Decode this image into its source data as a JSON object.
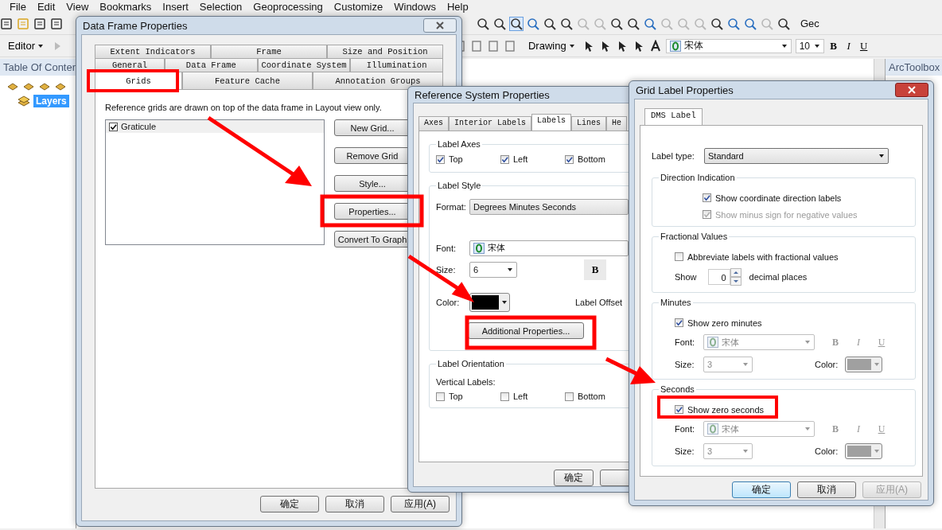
{
  "menu": [
    "File",
    "Edit",
    "View",
    "Bookmarks",
    "Insert",
    "Selection",
    "Geoprocessing",
    "Customize",
    "Windows",
    "Help"
  ],
  "toolbar": {
    "editor_menu": "Editor",
    "drawing_menu": "Drawing",
    "font": "宋体",
    "font_size": "10",
    "bold": "B",
    "italic": "I",
    "underline": "U",
    "cut_label": "Gec"
  },
  "toc": {
    "title": "Table Of Conten",
    "layers": {
      "label": "Layers",
      "selected": true
    }
  },
  "arctoolbox": {
    "title": "ArcToolbox"
  },
  "data_frame_dialog": {
    "title": "Data Frame Properties",
    "tab_rows": [
      [
        {
          "label": "Extent Indicators",
          "selected": false
        },
        {
          "label": "Frame",
          "selected": false
        },
        {
          "label": "Size and Position",
          "selected": false
        }
      ],
      [
        {
          "label": "General",
          "selected": false
        },
        {
          "label": "Data Frame",
          "selected": false
        },
        {
          "label": "Coordinate System",
          "selected": false
        },
        {
          "label": "Illumination",
          "selected": false
        }
      ],
      [
        {
          "label": "Grids",
          "selected": true
        },
        {
          "label": "Feature Cache",
          "selected": false
        },
        {
          "label": "Annotation Groups",
          "selected": false
        }
      ]
    ],
    "description": "Reference grids are drawn on top of the data frame in Layout view only.",
    "grids": [
      {
        "label": "Graticule",
        "checked": true
      }
    ],
    "buttons": [
      "New Grid...",
      "Remove Grid",
      "Style...",
      "Properties...",
      "Convert To Graph"
    ],
    "footer_buttons": [
      {
        "label": "确定",
        "disabled": false
      },
      {
        "label": "取消",
        "disabled": false
      },
      {
        "label": "应用(A)",
        "disabled": false
      }
    ]
  },
  "reference_dialog": {
    "title": "Reference System Properties",
    "tabs": [
      {
        "label": "Axes",
        "selected": false
      },
      {
        "label": "Interior Labels",
        "selected": false
      },
      {
        "label": "Labels",
        "selected": true
      },
      {
        "label": "Lines",
        "selected": false
      },
      {
        "label": "He",
        "selected": false
      }
    ],
    "label_axes": {
      "legend": "Label Axes",
      "options": [
        {
          "label": "Top",
          "checked": true
        },
        {
          "label": "Left",
          "checked": true
        },
        {
          "label": "Bottom",
          "checked": true
        }
      ]
    },
    "label_style": {
      "legend": "Label Style",
      "format_label": "Format:",
      "format": "Degrees Minutes Seconds",
      "font_label": "Font:",
      "font": "宋体",
      "size_label": "Size:",
      "size": "6",
      "bold": "B",
      "color_label": "Color:",
      "color": "#000000",
      "offset_label": "Label Offset",
      "additional_button": "Additional Properties..."
    },
    "label_orientation": {
      "legend": "Label Orientation",
      "vertical_label": "Vertical Labels:",
      "options": [
        {
          "label": "Top",
          "checked": false
        },
        {
          "label": "Left",
          "checked": false
        },
        {
          "label": "Bottom",
          "checked": false
        }
      ]
    },
    "footer_buttons": [
      "确定"
    ]
  },
  "grid_label_dialog": {
    "title": "Grid Label Properties",
    "tabs": [
      {
        "label": "DMS Label",
        "selected": true
      }
    ],
    "label_type_label": "Label type:",
    "label_type": "Standard",
    "direction": {
      "legend": "Direction Indication",
      "options": [
        {
          "label": "Show coordinate direction labels",
          "checked": true,
          "disabled": false
        },
        {
          "label": "Show minus sign for negative values",
          "checked": true,
          "disabled": true
        }
      ]
    },
    "fractional": {
      "legend": "Fractional Values",
      "abbreviate": {
        "label": "Abbreviate labels with fractional values",
        "checked": false
      },
      "show_label": "Show",
      "decimals": "0",
      "decimals_suffix": "decimal places"
    },
    "parts": [
      {
        "legend": "Minutes",
        "show_zero": {
          "label": "Show zero minutes",
          "checked": true
        },
        "font_label": "Font:",
        "font": "宋体",
        "size_label": "Size:",
        "size": "3",
        "color_label": "Color:",
        "color": "#a0a0a0",
        "bold": "B",
        "italic": "I",
        "underline": "U",
        "disabled": true
      },
      {
        "legend": "Seconds",
        "show_zero": {
          "label": "Show zero seconds",
          "checked": true
        },
        "font_label": "Font:",
        "font": "宋体",
        "size_label": "Size:",
        "size": "3",
        "color_label": "Color:",
        "color": "#a0a0a0",
        "bold": "B",
        "italic": "I",
        "underline": "U",
        "disabled": true
      }
    ],
    "footer_buttons": [
      {
        "label": "确定",
        "default": true,
        "disabled": false
      },
      {
        "label": "取消",
        "default": false,
        "disabled": false
      },
      {
        "label": "应用(A)",
        "default": false,
        "disabled": true
      }
    ]
  }
}
